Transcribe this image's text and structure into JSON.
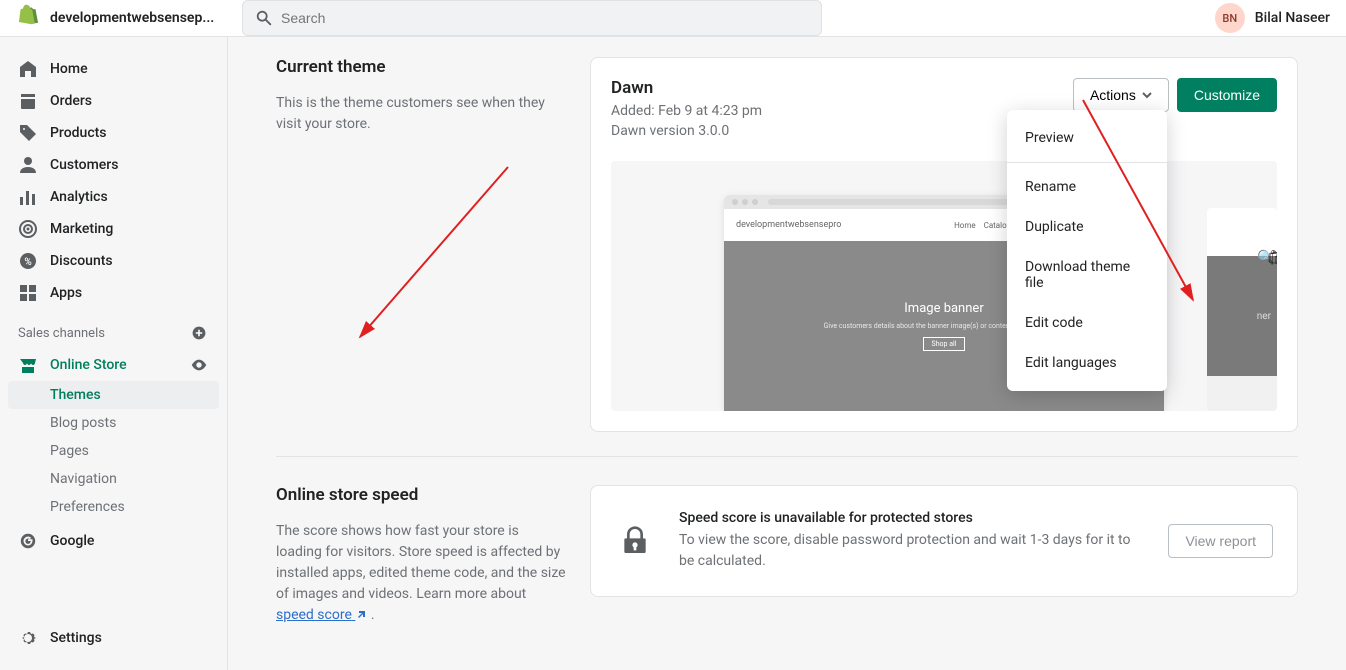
{
  "topbar": {
    "store_name": "developmentwebsensep...",
    "search_placeholder": "Search",
    "user_initials": "BN",
    "user_name": "Bilal Naseer"
  },
  "sidebar": {
    "main": [
      {
        "icon": "home",
        "label": "Home"
      },
      {
        "icon": "orders",
        "label": "Orders"
      },
      {
        "icon": "products",
        "label": "Products"
      },
      {
        "icon": "customers",
        "label": "Customers"
      },
      {
        "icon": "analytics",
        "label": "Analytics"
      },
      {
        "icon": "marketing",
        "label": "Marketing"
      },
      {
        "icon": "discounts",
        "label": "Discounts"
      },
      {
        "icon": "apps",
        "label": "Apps"
      }
    ],
    "channels_header": "Sales channels",
    "online_store": {
      "label": "Online Store"
    },
    "sub": [
      {
        "label": "Themes",
        "selected": true
      },
      {
        "label": "Blog posts"
      },
      {
        "label": "Pages"
      },
      {
        "label": "Navigation"
      },
      {
        "label": "Preferences"
      }
    ],
    "google": "Google",
    "settings": "Settings"
  },
  "theme_section": {
    "heading": "Current theme",
    "description": "This is the theme customers see when they visit your store."
  },
  "theme": {
    "name": "Dawn",
    "added": "Added: Feb 9 at 4:23 pm",
    "version": "Dawn version 3.0.0",
    "actions_btn": "Actions",
    "customize_btn": "Customize",
    "preview_store": "developmentwebsensepro",
    "preview_nav1": "Home",
    "preview_nav2": "Catalog",
    "banner_text": "Image banner",
    "banner_sub": "Give customers details about the banner image(s) or content on the template.",
    "banner_btn": "Shop all",
    "side_text": "ner"
  },
  "dropdown": {
    "preview": "Preview",
    "rename": "Rename",
    "duplicate": "Duplicate",
    "download": "Download theme file",
    "edit_code": "Edit code",
    "edit_lang": "Edit languages"
  },
  "speed_section": {
    "heading": "Online store speed",
    "description": "The score shows how fast your store is loading for visitors. Store speed is affected by installed apps, edited theme code, and the size of images and videos. Learn more about ",
    "link": "speed score"
  },
  "speed_card": {
    "title": "Speed score is unavailable for protected stores",
    "desc": "To view the score, disable password protection and wait 1-3 days for it to be calculated.",
    "button": "View report"
  }
}
